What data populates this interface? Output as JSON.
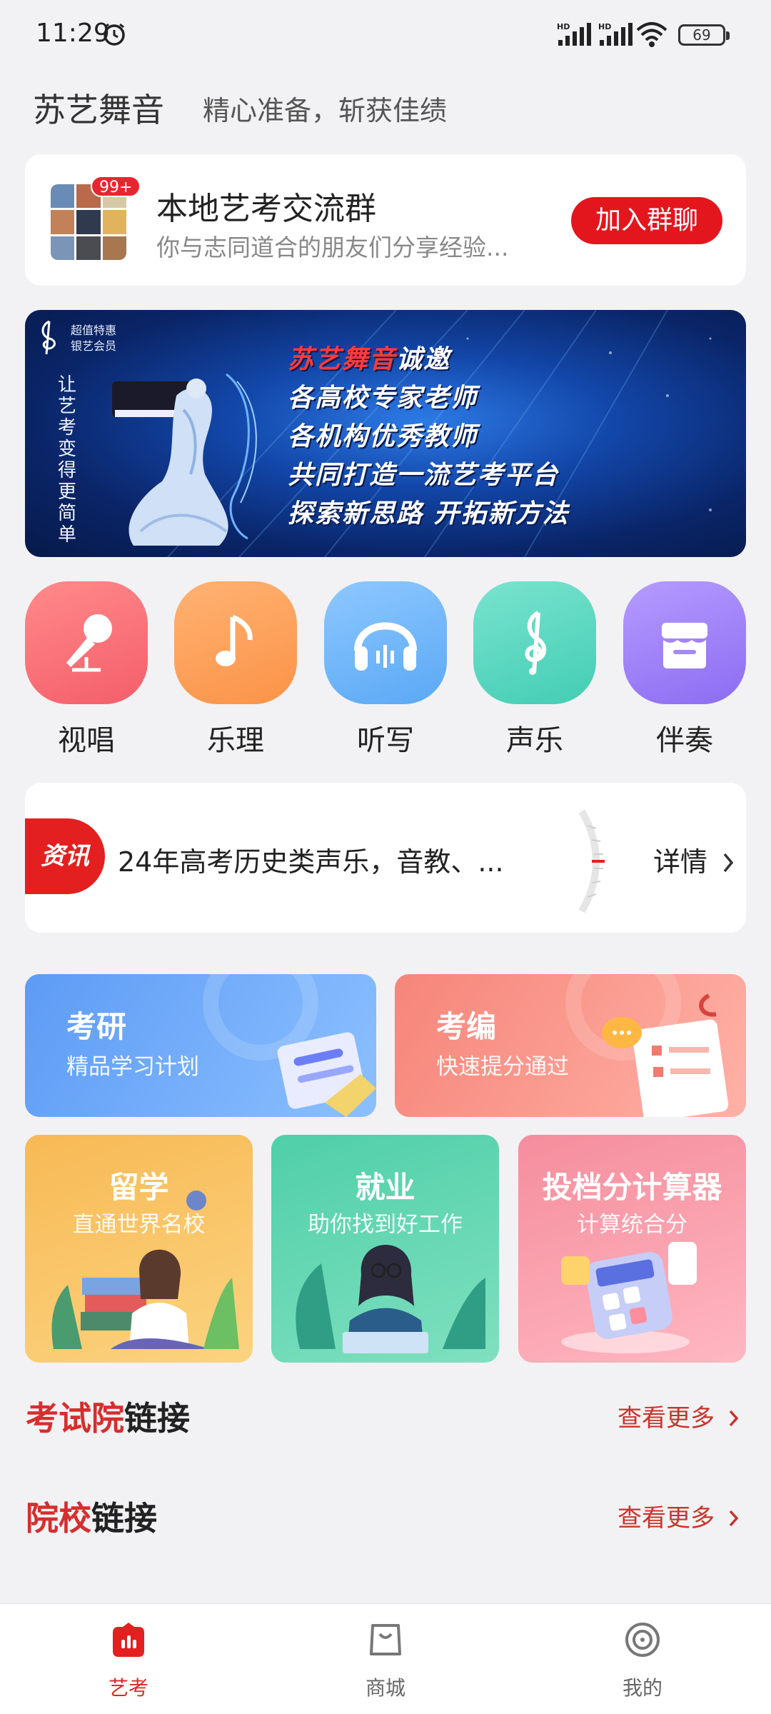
{
  "status_bar": {
    "time": "11:29",
    "battery": "69",
    "signal_tag": "HD"
  },
  "header": {
    "app_name": "苏艺舞音",
    "slogan": "精心准备，斩获佳绩"
  },
  "group": {
    "badge": "99+",
    "title": "本地艺考交流群",
    "subtitle": "你与志同道合的朋友们分享经验...",
    "join_label": "加入群聊"
  },
  "banner": {
    "promo_line1": "超值特惠",
    "promo_line2": "银艺会员",
    "vertical": [
      "让",
      "艺",
      "考",
      "变",
      "得",
      "更",
      "简",
      "单"
    ],
    "highlight": "苏艺舞音",
    "line1_rest": "诚邀",
    "lines": [
      "各高校专家老师",
      "各机构优秀教师",
      "共同打造一流艺考平台",
      "探索新思路 开拓新方法"
    ]
  },
  "features": [
    {
      "label": "视唱",
      "icon": "microphone-icon",
      "color_top": "#ff8a8a",
      "color_bottom": "#f45e6a"
    },
    {
      "label": "乐理",
      "icon": "music-note-icon",
      "color_top": "#ffb273",
      "color_bottom": "#fb9347"
    },
    {
      "label": "听写",
      "icon": "headphones-icon",
      "color_top": "#8ec8ff",
      "color_bottom": "#5aa8f5"
    },
    {
      "label": "声乐",
      "icon": "treble-clef-icon",
      "color_top": "#79e3cf",
      "color_bottom": "#43cdb4"
    },
    {
      "label": "伴奏",
      "icon": "store-icon",
      "color_top": "#b69bff",
      "color_bottom": "#8c6cf2"
    }
  ],
  "news": {
    "tag": "资讯",
    "text": "24年高考历史类声乐，音教、...",
    "more": "详情"
  },
  "promos_top": [
    {
      "title": "考研",
      "subtitle": "精品学习计划",
      "color_from": "#5d9bf5",
      "color_to": "#8cc0ff"
    },
    {
      "title": "考编",
      "subtitle": "快速提分通过",
      "color_from": "#f6857a",
      "color_to": "#ffb1a6"
    }
  ],
  "promos_bottom": [
    {
      "title": "留学",
      "subtitle": "直通世界名校",
      "color_from": "#f8b955",
      "color_to": "#fbd37f"
    },
    {
      "title": "就业",
      "subtitle": "助你找到好工作",
      "color_from": "#4fcfa8",
      "color_to": "#7fe0bf"
    },
    {
      "title": "投档分计算器",
      "subtitle": "计算统合分",
      "color_from": "#f58d9d",
      "color_to": "#ffb7c1"
    }
  ],
  "links": [
    {
      "title_red": "考试院",
      "title_rest": "链接",
      "more": "查看更多"
    },
    {
      "title_red": "院校",
      "title_rest": "链接",
      "more": "查看更多"
    }
  ],
  "bottom_nav": [
    {
      "label": "艺考",
      "icon": "home-icon",
      "active": true
    },
    {
      "label": "商城",
      "icon": "shopping-bag-icon",
      "active": false
    },
    {
      "label": "我的",
      "icon": "profile-disc-icon",
      "active": false
    }
  ],
  "colors": {
    "accent": "#e3161e",
    "background": "#f2f2f4"
  }
}
